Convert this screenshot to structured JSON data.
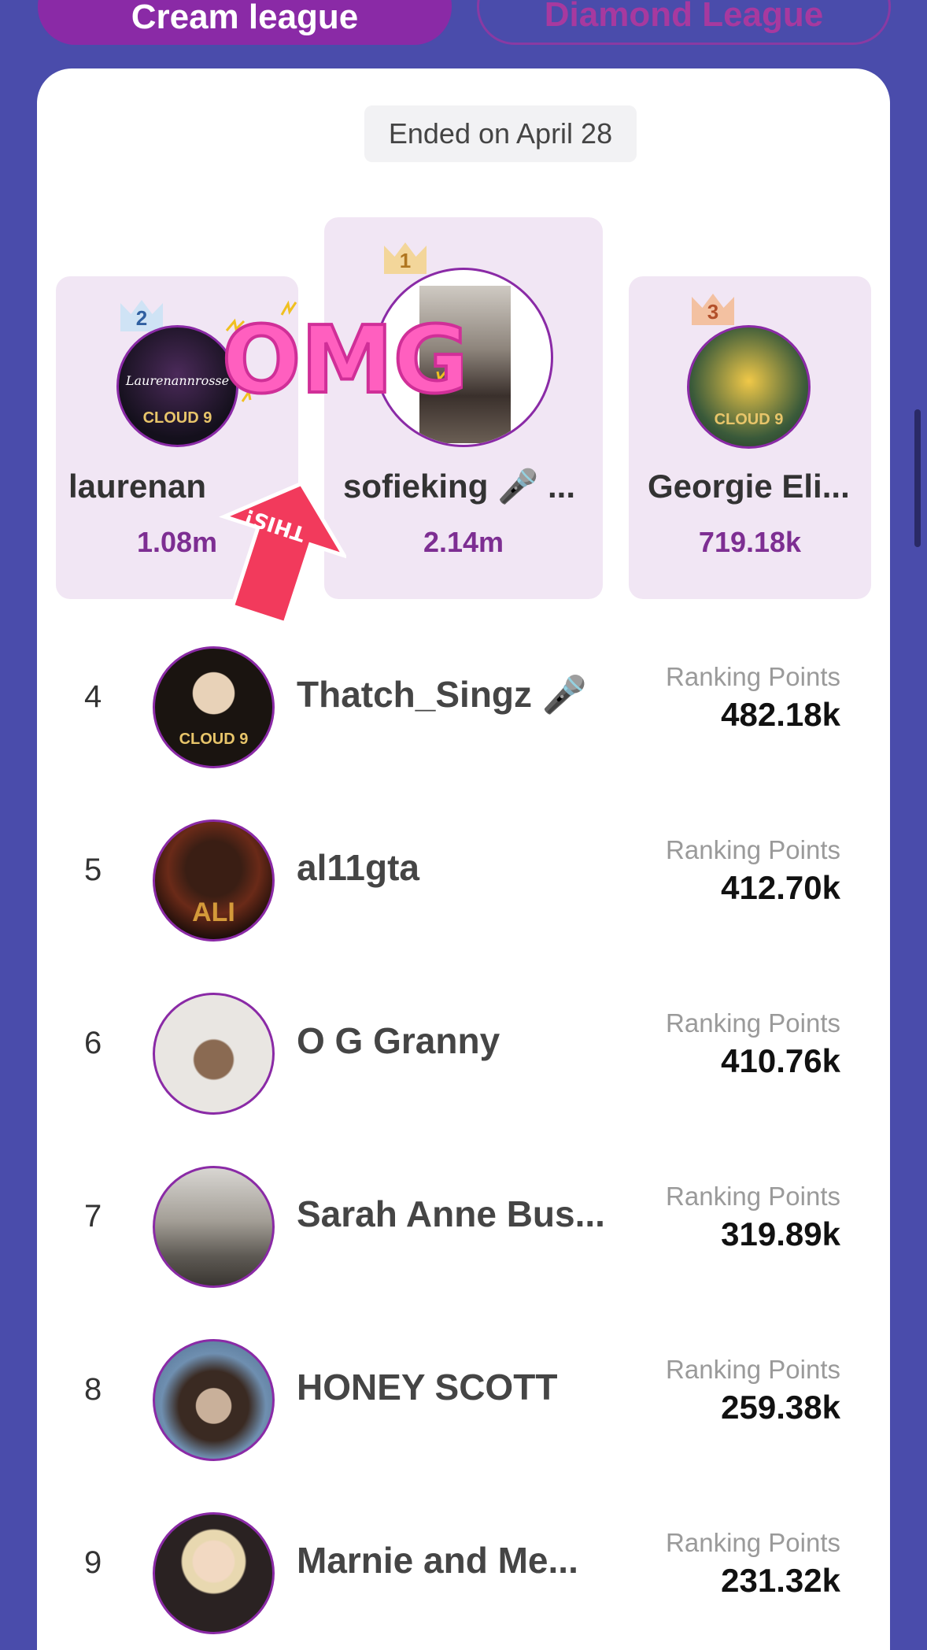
{
  "tabs": [
    {
      "label": "Cream league",
      "active": true
    },
    {
      "label": "Diamond League",
      "active": false
    }
  ],
  "ended_label": "Ended on April 28",
  "podium": [
    {
      "rank": "2",
      "name": "laurenan",
      "score": "1.08m",
      "avatar_text": "Laurenannrosse",
      "avatar_badge": "CLOUD 9"
    },
    {
      "rank": "1",
      "name": "sofieking 🎤 ...",
      "score": "2.14m"
    },
    {
      "rank": "3",
      "name": "Georgie Eli...",
      "score": "719.18k",
      "avatar_badge": "CLOUD 9"
    }
  ],
  "stickers": {
    "omg": "OMG",
    "arrow": "THIS!"
  },
  "ranking_label": "Ranking Points",
  "rows": [
    {
      "rank": "4",
      "name": "Thatch_Singz 🎤",
      "points": "482.18k",
      "badge": "CLOUD 9"
    },
    {
      "rank": "5",
      "name": "al11gta",
      "points": "412.70k",
      "badge": "ALI"
    },
    {
      "rank": "6",
      "name": "O G Granny",
      "points": "410.76k"
    },
    {
      "rank": "7",
      "name": "Sarah Anne Bus...",
      "points": "319.89k"
    },
    {
      "rank": "8",
      "name": "HONEY SCOTT",
      "points": "259.38k"
    },
    {
      "rank": "9",
      "name": "Marnie and Me...",
      "points": "231.32k"
    }
  ],
  "colors": {
    "background": "#4a4cab",
    "accent": "#8a2aa6",
    "podium_bg": "#f1e6f4",
    "score": "#7d2e92"
  }
}
